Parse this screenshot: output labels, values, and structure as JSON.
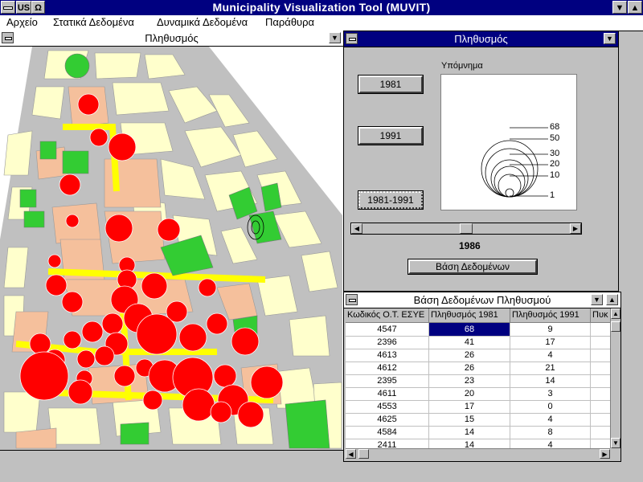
{
  "app": {
    "title": "Municipality Visualization Tool (MUVIT)",
    "sys_left": "US",
    "sys_omega": "Ω",
    "min": "▼",
    "max": "▲"
  },
  "menu": [
    "Αρχείο",
    "Στατικά Δεδομένα",
    "Δυναμικά Δεδομένα",
    "Παράθυρα"
  ],
  "map_window": {
    "title": "Πληθυσμός"
  },
  "control_window": {
    "title": "Πληθυσμός",
    "btn_1981": "1981",
    "btn_1991": "1991",
    "btn_range": "1981-1991",
    "legend_title": "Υπόμνημα",
    "legend_values": [
      "68",
      "50",
      "30",
      "20",
      "10",
      "1"
    ],
    "slider_value": "1986",
    "db_button": "Βάση Δεδομένων"
  },
  "colors": {
    "titlebar": "#000080",
    "block": "#ffffcc",
    "park": "#33cc33",
    "circle": "#ff0000",
    "road_yellow": "#ffff00",
    "peach": "#f5c09c",
    "road": "#c0c0c0"
  },
  "db_window": {
    "title": "Βάση Δεδομένων Πληθυσμού",
    "columns": [
      "Κωδικός Ο.Τ. ΕΣΥΕ",
      "Πληθυσμός 1981",
      "Πληθυσμός 1991",
      "Πυκ"
    ],
    "rows": [
      [
        "4547",
        "68",
        "9"
      ],
      [
        "2396",
        "41",
        "17"
      ],
      [
        "4613",
        "26",
        "4"
      ],
      [
        "4612",
        "26",
        "21"
      ],
      [
        "2395",
        "23",
        "14"
      ],
      [
        "4611",
        "20",
        "3"
      ],
      [
        "4553",
        "17",
        "0"
      ],
      [
        "4625",
        "15",
        "4"
      ],
      [
        "4584",
        "14",
        "8"
      ],
      [
        "2411",
        "14",
        "4"
      ]
    ]
  }
}
